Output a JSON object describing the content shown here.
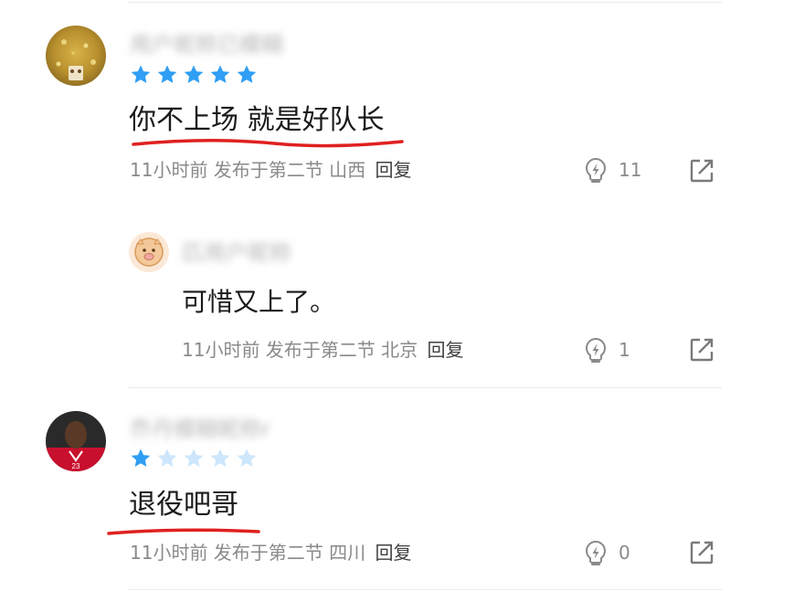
{
  "comments": [
    {
      "username": "用户昵称已模糊",
      "rating": 5,
      "text": "你不上场 就是好队长",
      "meta": "11小时前 发布于第二节 山西",
      "reply_label": "回复",
      "likes": "11",
      "reply": {
        "username": "匹用户昵称",
        "text": "可惜又上了。",
        "meta": "11小时前 发布于第二节 北京",
        "reply_label": "回复",
        "likes": "1"
      }
    },
    {
      "username": "乔丹模糊昵称r",
      "rating": 1,
      "text": "退役吧哥",
      "meta": "11小时前 发布于第二节 四川",
      "reply_label": "回复",
      "likes": "0"
    }
  ],
  "colors": {
    "star_filled": "#2f9ef4",
    "star_empty": "#cde6fb",
    "underline": "#e02020",
    "meta_text": "#8a8a8a",
    "divider": "#ececec"
  },
  "icons": {
    "like": "lightning-bulb-icon",
    "share": "share-arrow-icon"
  }
}
